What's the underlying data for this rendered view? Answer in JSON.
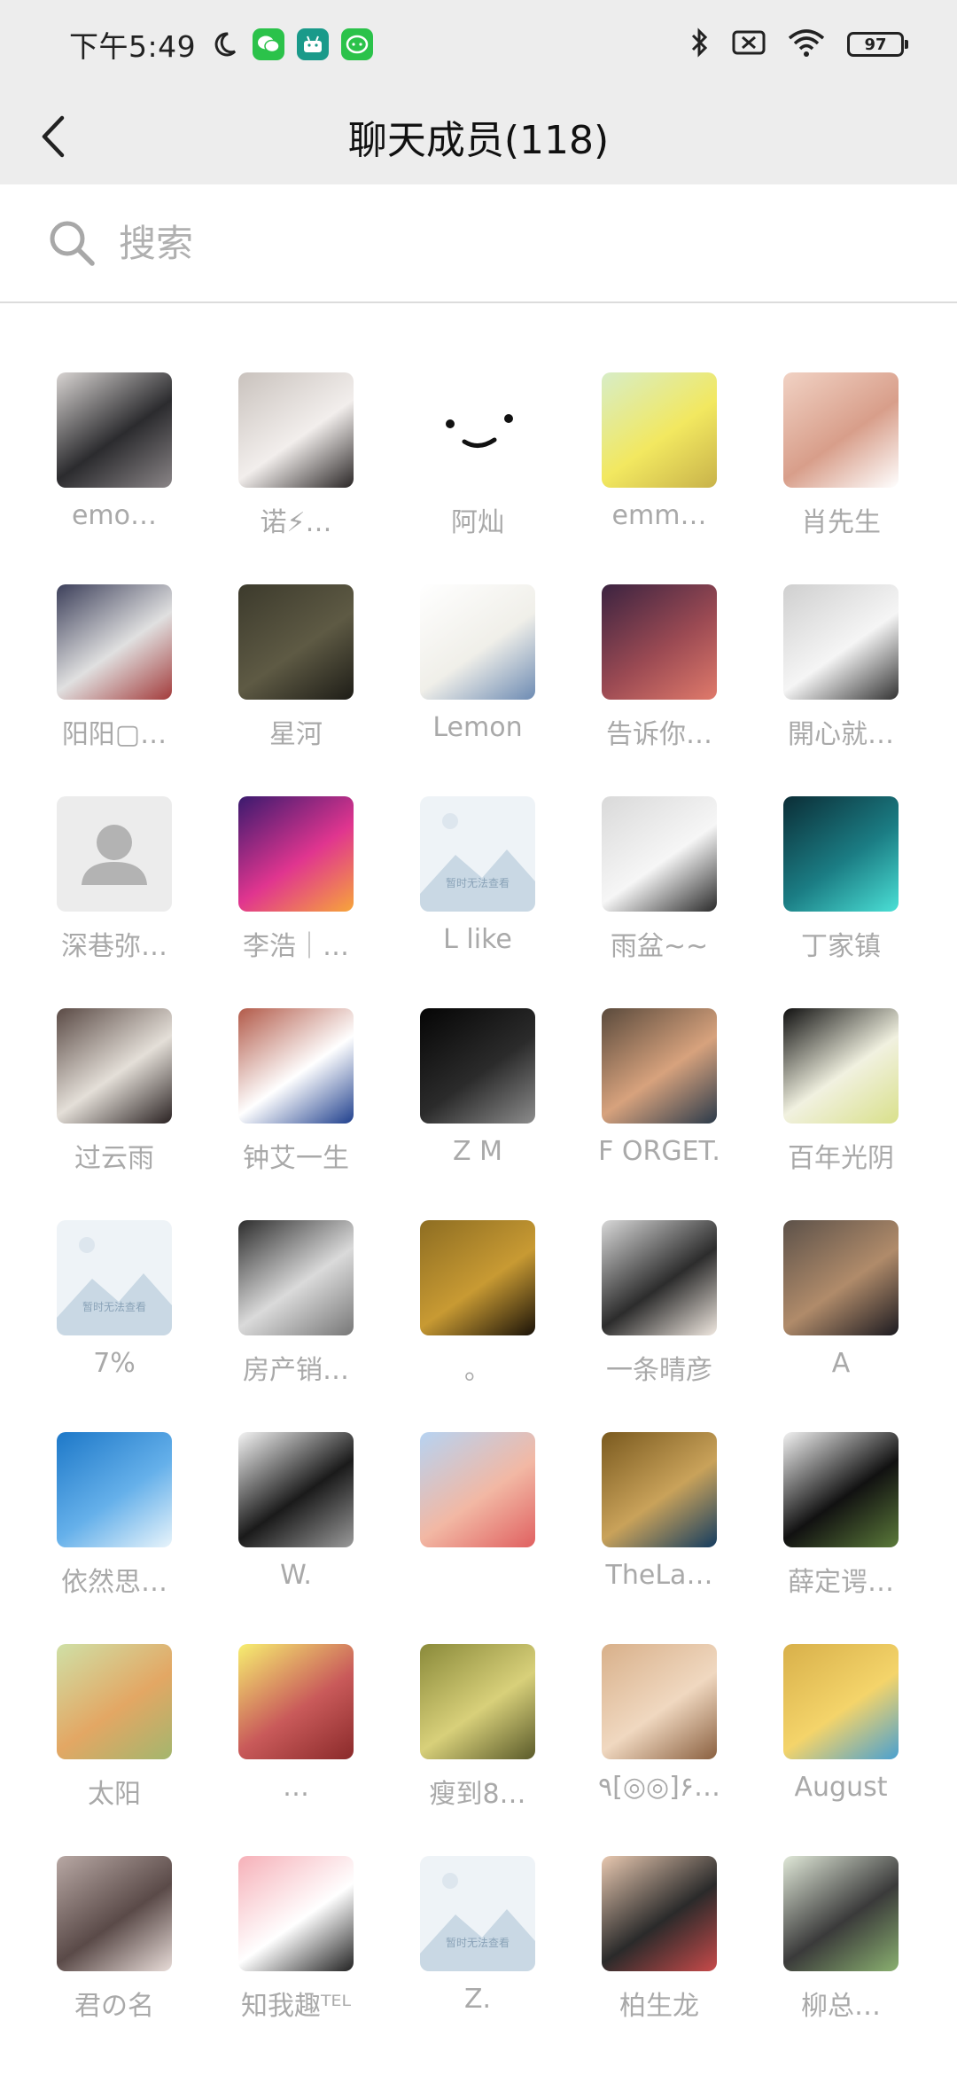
{
  "status_bar": {
    "time": "下午5:49",
    "battery": "97",
    "icons": [
      "moon-icon",
      "wechat-icon",
      "android-icon",
      "wechat-icon",
      "bluetooth-icon",
      "silent-icon",
      "wifi-icon",
      "battery-icon"
    ]
  },
  "header": {
    "title": "聊天成员(118)",
    "back_icon": "chevron-left-icon"
  },
  "search": {
    "placeholder": "搜索",
    "icon": "search-icon"
  },
  "placeholder_text": "暂时无法查看",
  "members": [
    {
      "name": "emo…",
      "avatar": {
        "type": "photo",
        "colors": [
          "#d8d4d2",
          "#2b2b2e",
          "#8a8587"
        ]
      }
    },
    {
      "name": "诺⚡…",
      "avatar": {
        "type": "photo",
        "colors": [
          "#c9c2bd",
          "#f2eeec",
          "#2a2626"
        ]
      }
    },
    {
      "name": "阿灿",
      "avatar": {
        "type": "smiley",
        "colors": [
          "#ffffff",
          "#111111"
        ]
      }
    },
    {
      "name": "emm…",
      "avatar": {
        "type": "photo",
        "colors": [
          "#d7edc7",
          "#f2e860",
          "#c8b24a"
        ]
      }
    },
    {
      "name": "肖先生",
      "avatar": {
        "type": "photo",
        "colors": [
          "#f1d2c4",
          "#d89e8a",
          "#ffffff"
        ]
      }
    },
    {
      "name": "阳阳▢…",
      "avatar": {
        "type": "photo",
        "colors": [
          "#3c3f5a",
          "#e0e0e0",
          "#a33b3b"
        ]
      }
    },
    {
      "name": "星河",
      "avatar": {
        "type": "photo",
        "colors": [
          "#3c3a2c",
          "#5e5a44",
          "#1e1d17"
        ]
      }
    },
    {
      "name": "Lemon",
      "avatar": {
        "type": "photo",
        "colors": [
          "#ffffff",
          "#f0efe9",
          "#6d8bb3"
        ]
      }
    },
    {
      "name": "告诉你…",
      "avatar": {
        "type": "photo",
        "colors": [
          "#3b2340",
          "#9b4a53",
          "#e07a6b"
        ]
      }
    },
    {
      "name": "開心就…",
      "avatar": {
        "type": "photo",
        "colors": [
          "#cfcfcf",
          "#f5f5f5",
          "#333333"
        ]
      }
    },
    {
      "name": "深巷弥…",
      "avatar": {
        "type": "default",
        "colors": [
          "#ececec",
          "#b3b3b3"
        ]
      }
    },
    {
      "name": "李浩｜…",
      "avatar": {
        "type": "photo",
        "colors": [
          "#3a1a6e",
          "#e0358f",
          "#f7a53a"
        ]
      }
    },
    {
      "name": "L like",
      "avatar": {
        "type": "unavailable",
        "colors": [
          "#eef3f7",
          "#c9d8e4"
        ]
      }
    },
    {
      "name": "雨盆~~",
      "avatar": {
        "type": "photo",
        "colors": [
          "#d9d9d9",
          "#f6f6f6",
          "#2a2a2a"
        ]
      }
    },
    {
      "name": "丁家镇",
      "avatar": {
        "type": "photo",
        "colors": [
          "#0b2d36",
          "#1b7d84",
          "#4be0d6"
        ]
      }
    },
    {
      "name": "过云雨",
      "avatar": {
        "type": "photo",
        "colors": [
          "#5a4a45",
          "#e4dfd8",
          "#2a2222"
        ]
      }
    },
    {
      "name": "钟艾一生",
      "avatar": {
        "type": "photo",
        "colors": [
          "#b25a49",
          "#ffffff",
          "#1f3f8d"
        ]
      }
    },
    {
      "name": "Z M",
      "avatar": {
        "type": "photo",
        "colors": [
          "#050505",
          "#2b2b2b",
          "#8c8c8c"
        ]
      }
    },
    {
      "name": "F ORGET.",
      "avatar": {
        "type": "photo",
        "colors": [
          "#5a4a3c",
          "#d7a27d",
          "#2b3a4a"
        ]
      }
    },
    {
      "name": "百年光阴",
      "avatar": {
        "type": "photo",
        "colors": [
          "#101010",
          "#f1f1e0",
          "#d9e08a"
        ]
      }
    },
    {
      "name": "7%",
      "avatar": {
        "type": "unavailable",
        "colors": [
          "#eef3f7",
          "#c9d8e4"
        ]
      }
    },
    {
      "name": "房产销…",
      "avatar": {
        "type": "photo",
        "colors": [
          "#2d2d2d",
          "#dadada",
          "#777777"
        ]
      }
    },
    {
      "name": "。",
      "avatar": {
        "type": "photo",
        "colors": [
          "#8d6d22",
          "#c89a33",
          "#1a1208"
        ]
      }
    },
    {
      "name": "一条晴彦",
      "avatar": {
        "type": "photo",
        "colors": [
          "#d8d8d8",
          "#2c2c2c",
          "#f0e8e0"
        ]
      }
    },
    {
      "name": "A",
      "avatar": {
        "type": "photo",
        "colors": [
          "#5c5149",
          "#b08b6a",
          "#1c1a20"
        ]
      }
    },
    {
      "name": "依然思…",
      "avatar": {
        "type": "photo",
        "colors": [
          "#1d78c8",
          "#65b0ea",
          "#e8f4fb"
        ]
      }
    },
    {
      "name": "W.",
      "avatar": {
        "type": "photo",
        "colors": [
          "#f4f4f4",
          "#1a1a1a",
          "#9a9a9a"
        ]
      }
    },
    {
      "name": "",
      "avatar": {
        "type": "photo",
        "colors": [
          "#b6d3f2",
          "#f2b8a4",
          "#e06060"
        ]
      }
    },
    {
      "name": "TheLa…",
      "avatar": {
        "type": "photo",
        "colors": [
          "#7a5a1f",
          "#c9a25a",
          "#143c60"
        ]
      }
    },
    {
      "name": "薛定谔…",
      "avatar": {
        "type": "photo",
        "colors": [
          "#f2f2f2",
          "#111111",
          "#5b7a3a"
        ]
      }
    },
    {
      "name": "太阳",
      "avatar": {
        "type": "photo",
        "colors": [
          "#cfe0a6",
          "#e3a764",
          "#a3b66e"
        ]
      }
    },
    {
      "name": "…",
      "avatar": {
        "type": "photo",
        "colors": [
          "#f7ef70",
          "#c95a5a",
          "#8a2a2a"
        ]
      }
    },
    {
      "name": "瘦到8…",
      "avatar": {
        "type": "photo",
        "colors": [
          "#8a8a3a",
          "#d8d07a",
          "#5a5a2a"
        ]
      }
    },
    {
      "name": "٩[◎◎]۶…",
      "avatar": {
        "type": "photo",
        "colors": [
          "#d8b08a",
          "#f0d8c0",
          "#8a6040"
        ]
      }
    },
    {
      "name": "August",
      "avatar": {
        "type": "photo",
        "colors": [
          "#d8b04a",
          "#f4d46a",
          "#4aa0d0"
        ]
      }
    },
    {
      "name": "君の名",
      "avatar": {
        "type": "photo",
        "colors": [
          "#b8a8a4",
          "#5a4a48",
          "#e8dcd8"
        ]
      }
    },
    {
      "name": "知我趣ᵀᴱᴸ",
      "avatar": {
        "type": "photo",
        "colors": [
          "#f6b0b8",
          "#ffffff",
          "#222222"
        ]
      }
    },
    {
      "name": "Z.",
      "avatar": {
        "type": "unavailable",
        "colors": [
          "#eef3f7",
          "#c9d8e4"
        ]
      }
    },
    {
      "name": "柏生龙",
      "avatar": {
        "type": "photo",
        "colors": [
          "#e8c8b0",
          "#2a2a2a",
          "#c84a4a"
        ]
      }
    },
    {
      "name": "柳总…",
      "avatar": {
        "type": "photo",
        "colors": [
          "#e0e8d8",
          "#3a3a3a",
          "#8ab070"
        ]
      }
    }
  ]
}
